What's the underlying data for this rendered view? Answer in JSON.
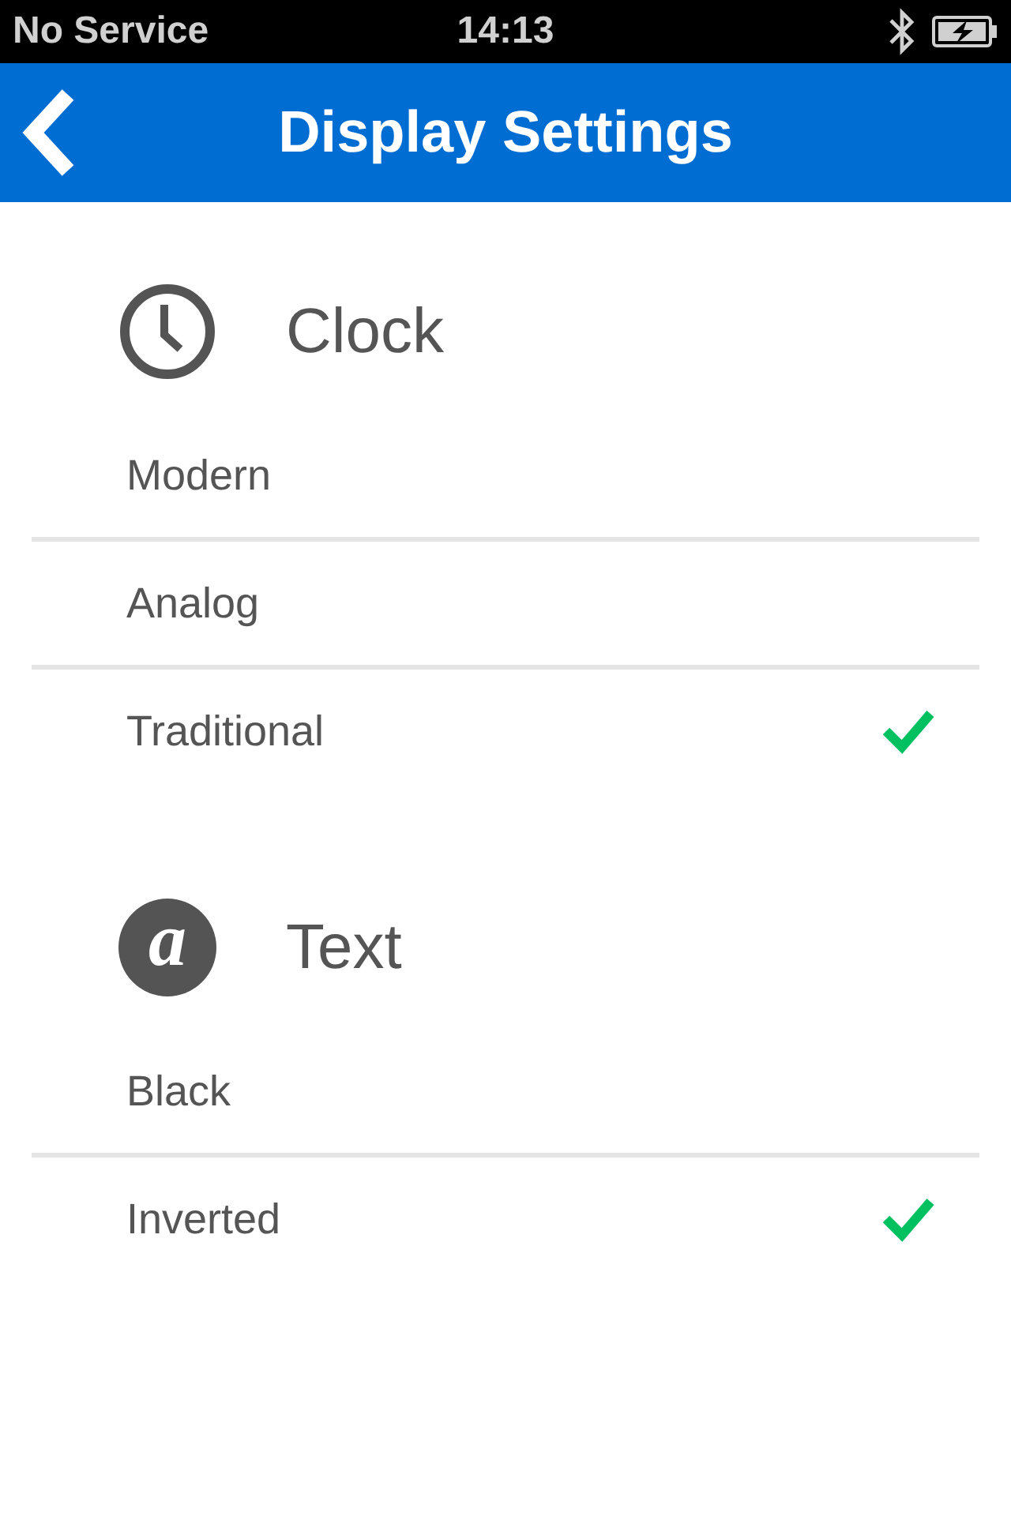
{
  "status_bar": {
    "carrier": "No Service",
    "time": "14:13"
  },
  "nav_bar": {
    "title": "Display Settings"
  },
  "sections": [
    {
      "title": "Clock",
      "kind": "clock",
      "options": [
        {
          "label": "Modern",
          "selected": false
        },
        {
          "label": "Analog",
          "selected": false
        },
        {
          "label": "Traditional",
          "selected": true
        }
      ]
    },
    {
      "title": "Text",
      "kind": "letter",
      "icon_letter": "a",
      "options": [
        {
          "label": "Black",
          "selected": false
        },
        {
          "label": "Inverted",
          "selected": true
        }
      ]
    }
  ]
}
